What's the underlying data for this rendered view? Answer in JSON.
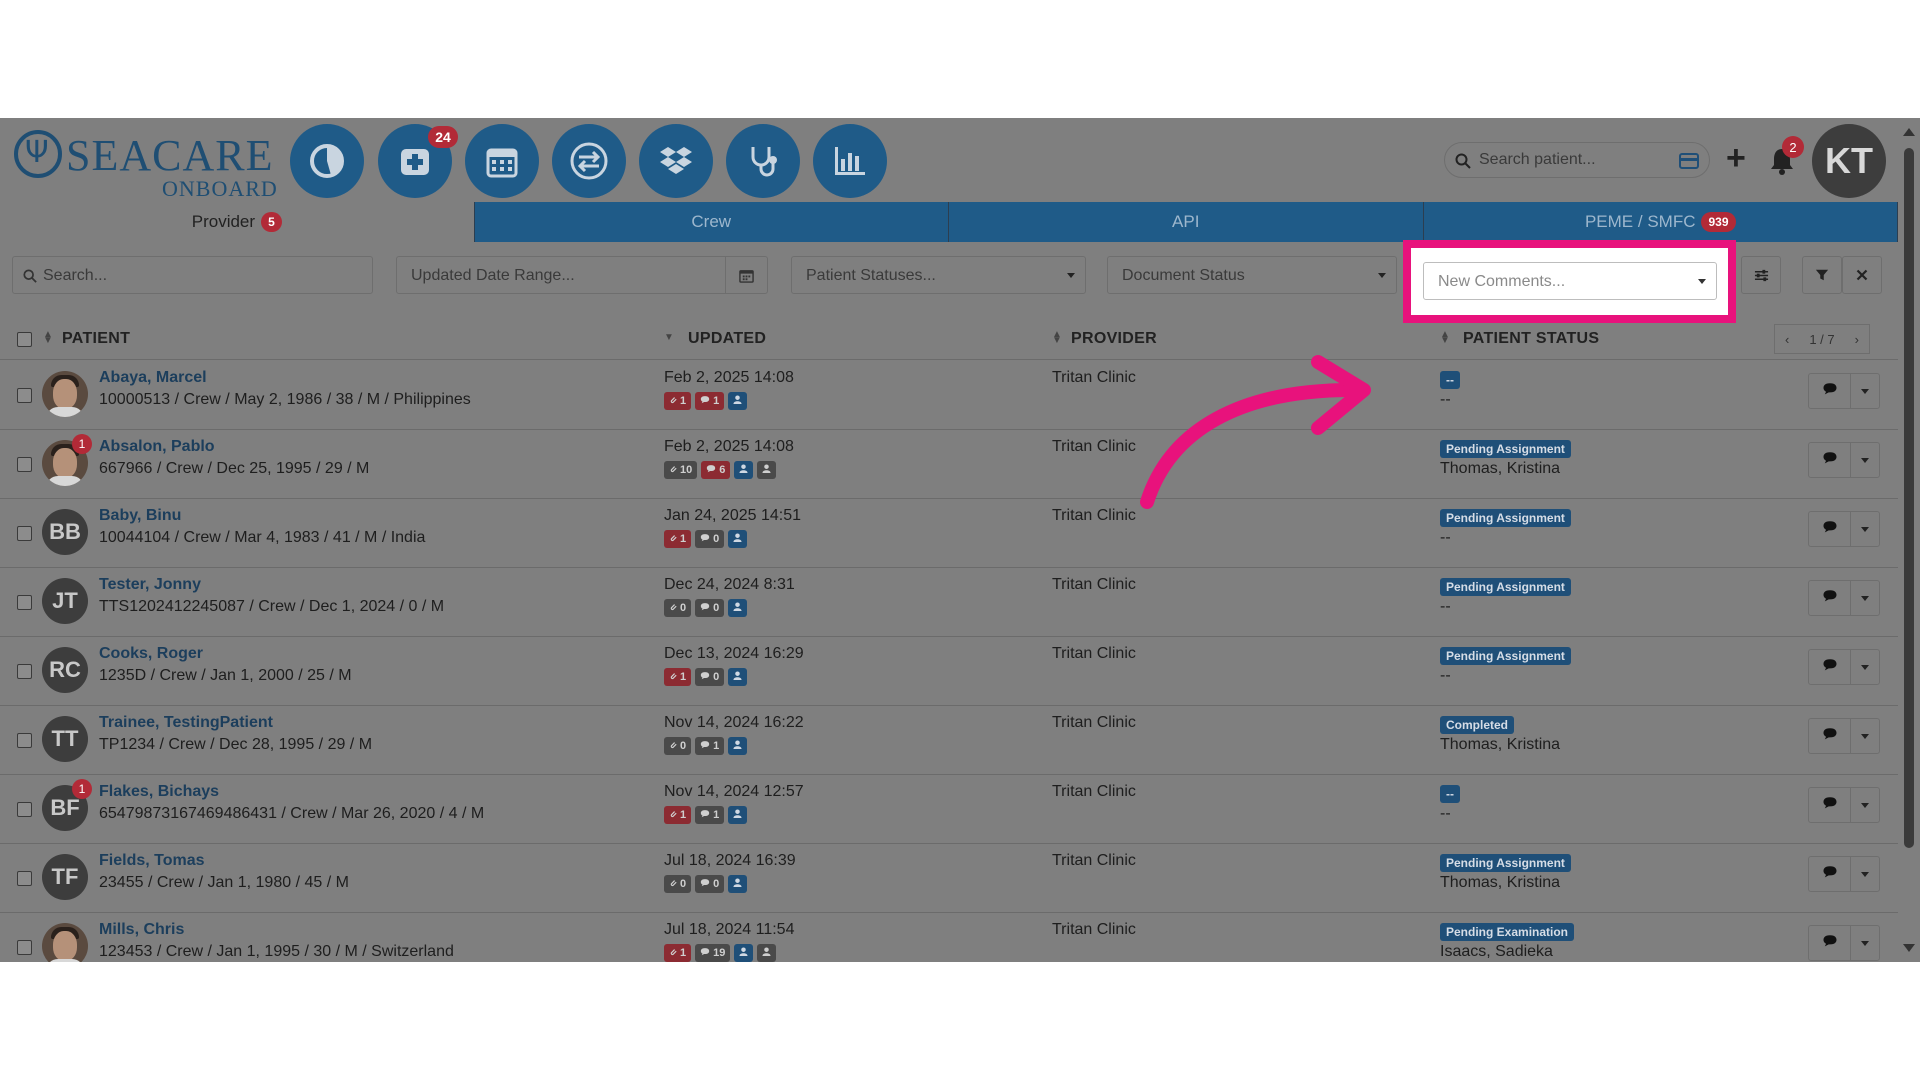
{
  "header": {
    "logo_main": "SEACARE",
    "logo_sub": "ONBOARD",
    "nav_badge_add": "24",
    "search_placeholder": "Search patient...",
    "notif_count": "2",
    "user_initials": "KT"
  },
  "tabs": [
    {
      "label": "Provider",
      "badge": "5"
    },
    {
      "label": "Crew"
    },
    {
      "label": "API"
    },
    {
      "label": "PEME / SMFC",
      "badge": "939"
    }
  ],
  "filters": {
    "search_placeholder": "Search...",
    "date_range_placeholder": "Updated Date Range...",
    "patient_statuses_placeholder": "Patient Statuses...",
    "document_status_placeholder": "Document Status",
    "new_comments_placeholder": "New Comments..."
  },
  "table": {
    "headers": {
      "patient": "PATIENT",
      "updated": "UPDATED",
      "provider": "PROVIDER",
      "status": "PATIENT STATUS"
    },
    "pager": "1 / 7",
    "rows": [
      {
        "name": "Abaya, Marcel",
        "info": "10000513 / Crew / May 2, 1986 / 38 / M / Philippines",
        "initials": "",
        "photo": true,
        "badge": "",
        "updated": "Feb 2, 2025 14:08",
        "attach": "1",
        "comments": "1",
        "extra_user": false,
        "provider": "Tritan Clinic",
        "status": "--",
        "assignee": "--"
      },
      {
        "name": "Absalon, Pablo",
        "info": "667966 / Crew / Dec 25, 1995 / 29 / M",
        "initials": "",
        "photo": true,
        "badge": "1",
        "updated": "Feb 2, 2025 14:08",
        "attach": "10",
        "comments": "6",
        "extra_user": true,
        "provider": "Tritan Clinic",
        "status": "Pending Assignment",
        "assignee": "Thomas, Kristina"
      },
      {
        "name": "Baby, Binu",
        "info": "10044104 / Crew / Mar 4, 1983 / 41 / M / India",
        "initials": "BB",
        "photo": false,
        "badge": "",
        "updated": "Jan 24, 2025 14:51",
        "attach": "1",
        "comments": "0",
        "extra_user": false,
        "provider": "Tritan Clinic",
        "status": "Pending Assignment",
        "assignee": "--"
      },
      {
        "name": "Tester, Jonny",
        "info": "TTS1202412245087 / Crew / Dec 1, 2024 / 0 / M",
        "initials": "JT",
        "photo": false,
        "badge": "",
        "updated": "Dec 24, 2024 8:31",
        "attach": "0",
        "comments": "0",
        "extra_user": false,
        "provider": "Tritan Clinic",
        "status": "Pending Assignment",
        "assignee": "--"
      },
      {
        "name": "Cooks, Roger",
        "info": "1235D / Crew / Jan 1, 2000 / 25 / M",
        "initials": "RC",
        "photo": false,
        "badge": "",
        "updated": "Dec 13, 2024 16:29",
        "attach": "1",
        "comments": "0",
        "extra_user": false,
        "provider": "Tritan Clinic",
        "status": "Pending Assignment",
        "assignee": "--"
      },
      {
        "name": "Trainee, TestingPatient",
        "info": "TP1234 / Crew / Dec 28, 1995 / 29 / M",
        "initials": "TT",
        "photo": false,
        "badge": "",
        "updated": "Nov 14, 2024 16:22",
        "attach": "0",
        "comments": "1",
        "extra_user": false,
        "provider": "Tritan Clinic",
        "status": "Completed",
        "assignee": "Thomas, Kristina"
      },
      {
        "name": "Flakes, Bichays",
        "info": "654798731674694864​31 / Crew / Mar 26, 2020 / 4 / M",
        "initials": "BF",
        "photo": false,
        "badge": "1",
        "updated": "Nov 14, 2024 12:57",
        "attach": "1",
        "comments": "1",
        "extra_user": false,
        "provider": "Tritan Clinic",
        "status": "--",
        "assignee": "--"
      },
      {
        "name": "Fields, Tomas",
        "info": "23455 / Crew / Jan 1, 1980 / 45 / M",
        "initials": "TF",
        "photo": false,
        "badge": "",
        "updated": "Jul 18, 2024 16:39",
        "attach": "0",
        "comments": "0",
        "extra_user": false,
        "provider": "Tritan Clinic",
        "status": "Pending Assignment",
        "assignee": "Thomas, Kristina"
      },
      {
        "name": "Mills, Chris",
        "info": "123453 / Crew / Jan 1, 1995 / 30 / M / Switzerland",
        "initials": "",
        "photo": true,
        "badge": "",
        "updated": "Jul 18, 2024 11:54",
        "attach": "1",
        "comments": "19",
        "extra_user": true,
        "provider": "Tritan Clinic",
        "status": "Pending Examination",
        "assignee": "Isaacs, Sadieka"
      }
    ]
  },
  "colors": {
    "brand": "#1f5b88",
    "badge": "#b22a37",
    "highlight": "#e8127c",
    "overlay": "#7f7f7f"
  }
}
